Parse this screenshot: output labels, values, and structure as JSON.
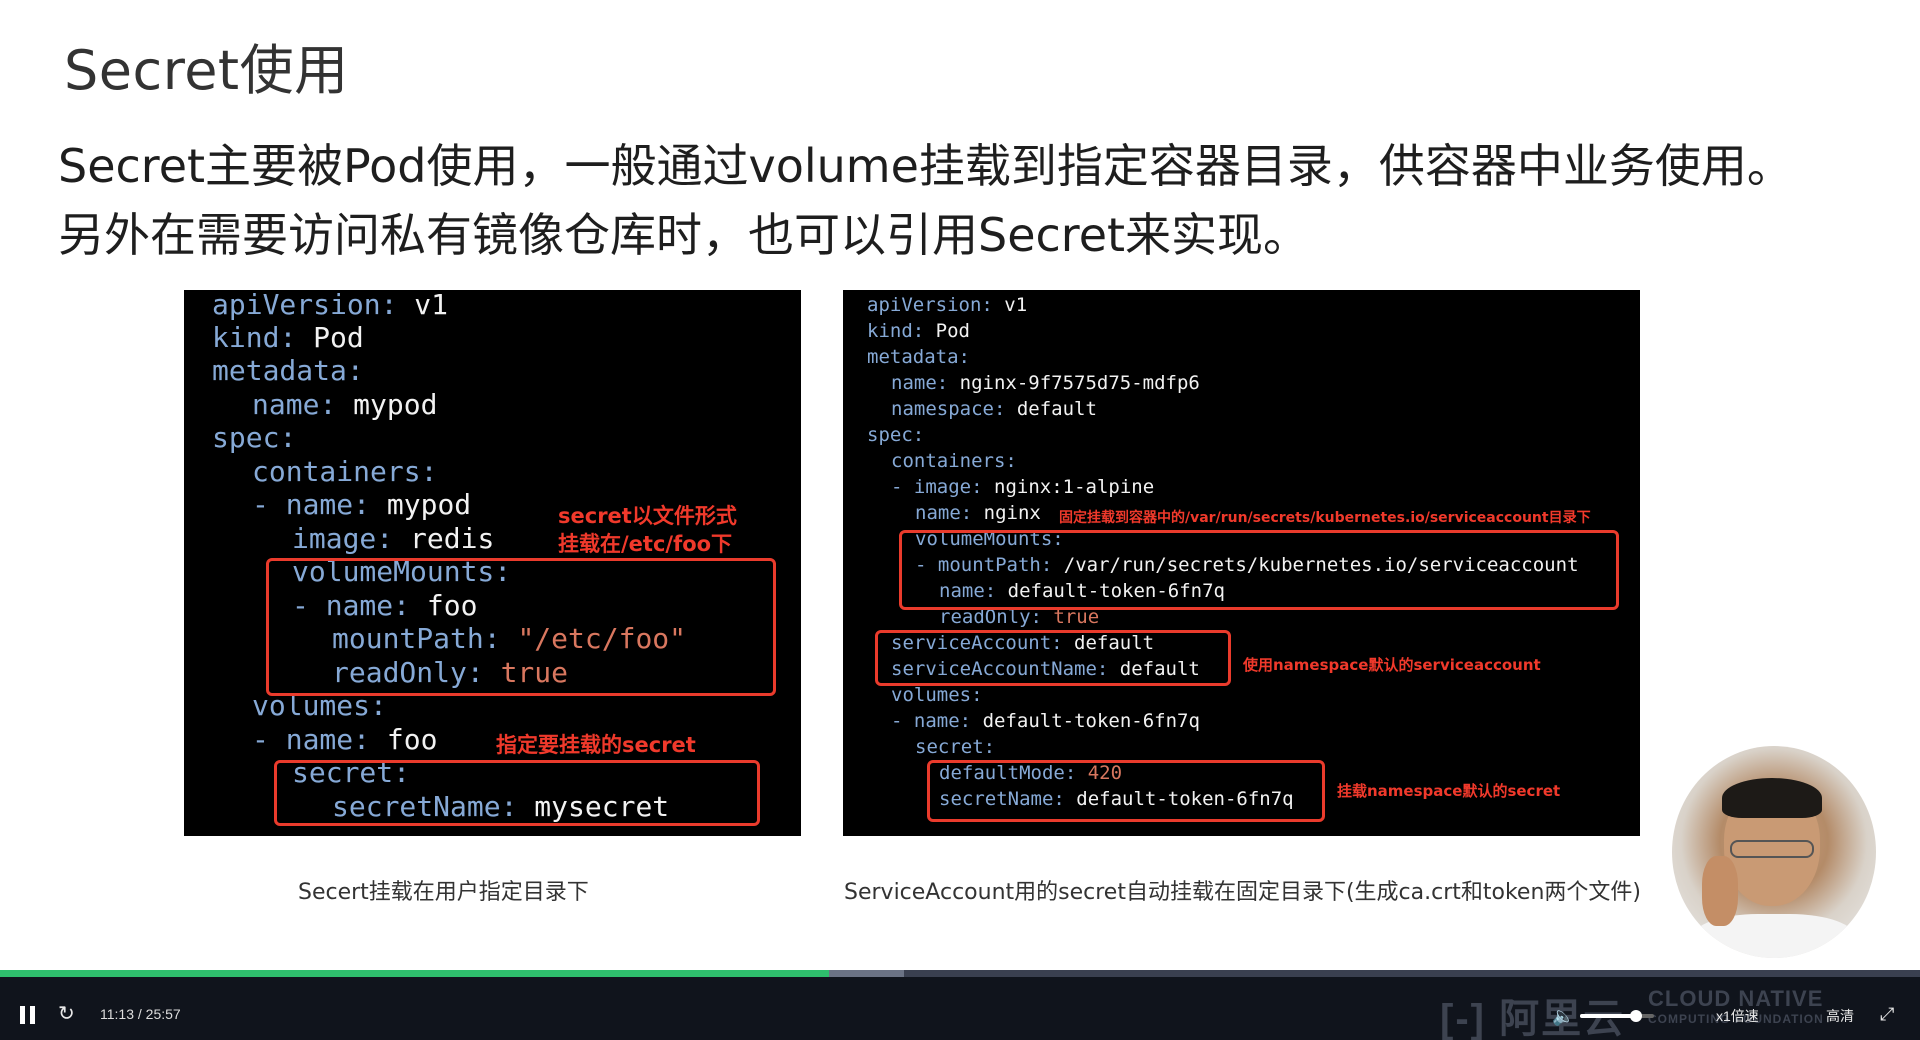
{
  "slide": {
    "title": "Secret使用",
    "intro": "Secret主要被Pod使用，一般通过volume挂载到指定容器目录，供容器中业务使用。另外在需要访问私有镜像仓库时，也可以引用Secret来实现。",
    "left_code": {
      "lines": {
        "l1_key": "apiVersion",
        "l1_val": "v1",
        "l2_key": "kind",
        "l2_val": "Pod",
        "l3_key": "metadata",
        "l4_key": "name",
        "l4_val": "mypod",
        "l5_key": "spec",
        "l6_key": "containers",
        "l7_dash": "-",
        "l7_key": "name",
        "l7_val": "mypod",
        "l8_key": "image",
        "l8_val": "redis",
        "l9_key": "volumeMounts",
        "l10_dash": "-",
        "l10_key": "name",
        "l10_val": "foo",
        "l11_key": "mountPath",
        "l11_val": "\"/etc/foo\"",
        "l12_key": "readOnly",
        "l12_val": "true",
        "l13_key": "volumes",
        "l14_dash": "-",
        "l14_key": "name",
        "l14_val": "foo",
        "l15_key": "secret",
        "l16_key": "secretName",
        "l16_val": "mysecret"
      },
      "notes": {
        "mount_note_1": "secret以文件形式",
        "mount_note_2": "挂载在/etc/foo下",
        "secret_note": "指定要挂载的secret"
      }
    },
    "right_code": {
      "lines": {
        "l1_key": "apiVersion",
        "l1_val": "v1",
        "l2_key": "kind",
        "l2_val": "Pod",
        "l3_key": "metadata",
        "l4_key": "name",
        "l4_val": "nginx-9f7575d75-mdfp6",
        "l5_key": "namespace",
        "l5_val": "default",
        "l6_key": "spec",
        "l7_key": "containers",
        "l8_dash": "-",
        "l8_key": "image",
        "l8_val": "nginx:1-alpine",
        "l9_key": "name",
        "l9_val": "nginx",
        "l10_key": "volumeMounts",
        "l11_dash": "-",
        "l11_key": "mountPath",
        "l11_val": "/var/run/secrets/kubernetes.io/serviceaccount",
        "l12_key": "name",
        "l12_val": "default-token-6fn7q",
        "l13_key": "readOnly",
        "l13_val": "true",
        "l14_key": "serviceAccount",
        "l14_val": "default",
        "l15_key": "serviceAccountName",
        "l15_val": "default",
        "l16_key": "volumes",
        "l17_dash": "-",
        "l17_key": "name",
        "l17_val": "default-token-6fn7q",
        "l18_key": "secret",
        "l19_key": "defaultMode",
        "l19_val": "420",
        "l20_key": "secretName",
        "l20_val": "default-token-6fn7q"
      },
      "notes": {
        "mount_note": "固定挂载到容器中的/var/run/secrets/kubernetes.io/serviceaccount目录下",
        "sa_note": "使用namespace默认的serviceaccount",
        "secret_note": "挂载namespace默认的secret"
      }
    },
    "captions": {
      "left": "Secert挂载在用户指定目录下",
      "right": "ServiceAccount用的secret自动挂载在固定目录下(生成ca.crt和token两个文件)"
    }
  },
  "player": {
    "time": "11:13 / 25:57",
    "progress": 0.432,
    "buffered": 0.471,
    "volume": 0.75,
    "speed_label": "x1倍速",
    "quality_label": "高清",
    "brand_aliyun": "阿里云",
    "brand_cncf_1": "CLOUD NATIVE",
    "brand_cncf_2": "COMPUTING FOUNDATION",
    "colors": {
      "progress": "#2fbf6d",
      "bar": "#10141c",
      "annotation": "#ea3b2c"
    },
    "icons": [
      "pause-icon",
      "replay-icon",
      "volume-icon",
      "fullscreen-icon"
    ]
  }
}
